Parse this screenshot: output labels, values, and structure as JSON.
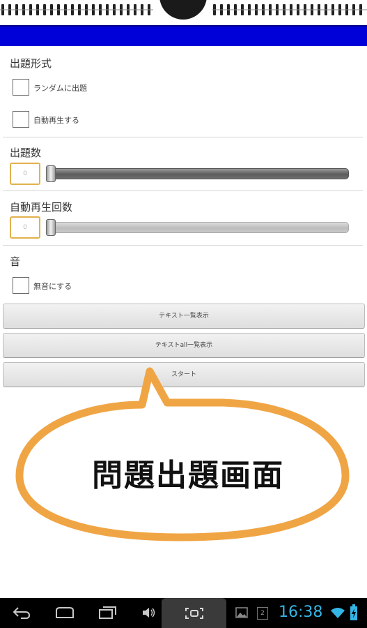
{
  "sections": {
    "format_label": "出題形式",
    "count_label": "出題数",
    "autoplay_count_label": "自動再生回数",
    "sound_label": "音"
  },
  "options": {
    "random_label": "ランダムに出題",
    "autoplay_label": "自動再生する",
    "mute_label": "無音にする"
  },
  "inputs": {
    "count_value": "0",
    "autoplay_count_value": "0"
  },
  "sliders": {
    "count_fraction": 0,
    "autoplay_count_fraction": 0
  },
  "buttons": {
    "text_list_label": "テキスト一覧表示",
    "text_all_list_label": "テキストall一覧表示",
    "start_label": "スタート"
  },
  "bubble": {
    "caption": "問題出題画面",
    "color": "#f0a545"
  },
  "status_bar": {
    "time": "16:38",
    "notification_count": "2"
  },
  "colors": {
    "header_band": "#0000d8",
    "clock": "#33b5e5",
    "input_border": "#e2b14d"
  },
  "icons": [
    "back-icon",
    "home-icon",
    "recent-apps-icon",
    "volume-icon",
    "screenshot-icon",
    "gallery-icon",
    "wifi-icon",
    "battery-icon"
  ]
}
